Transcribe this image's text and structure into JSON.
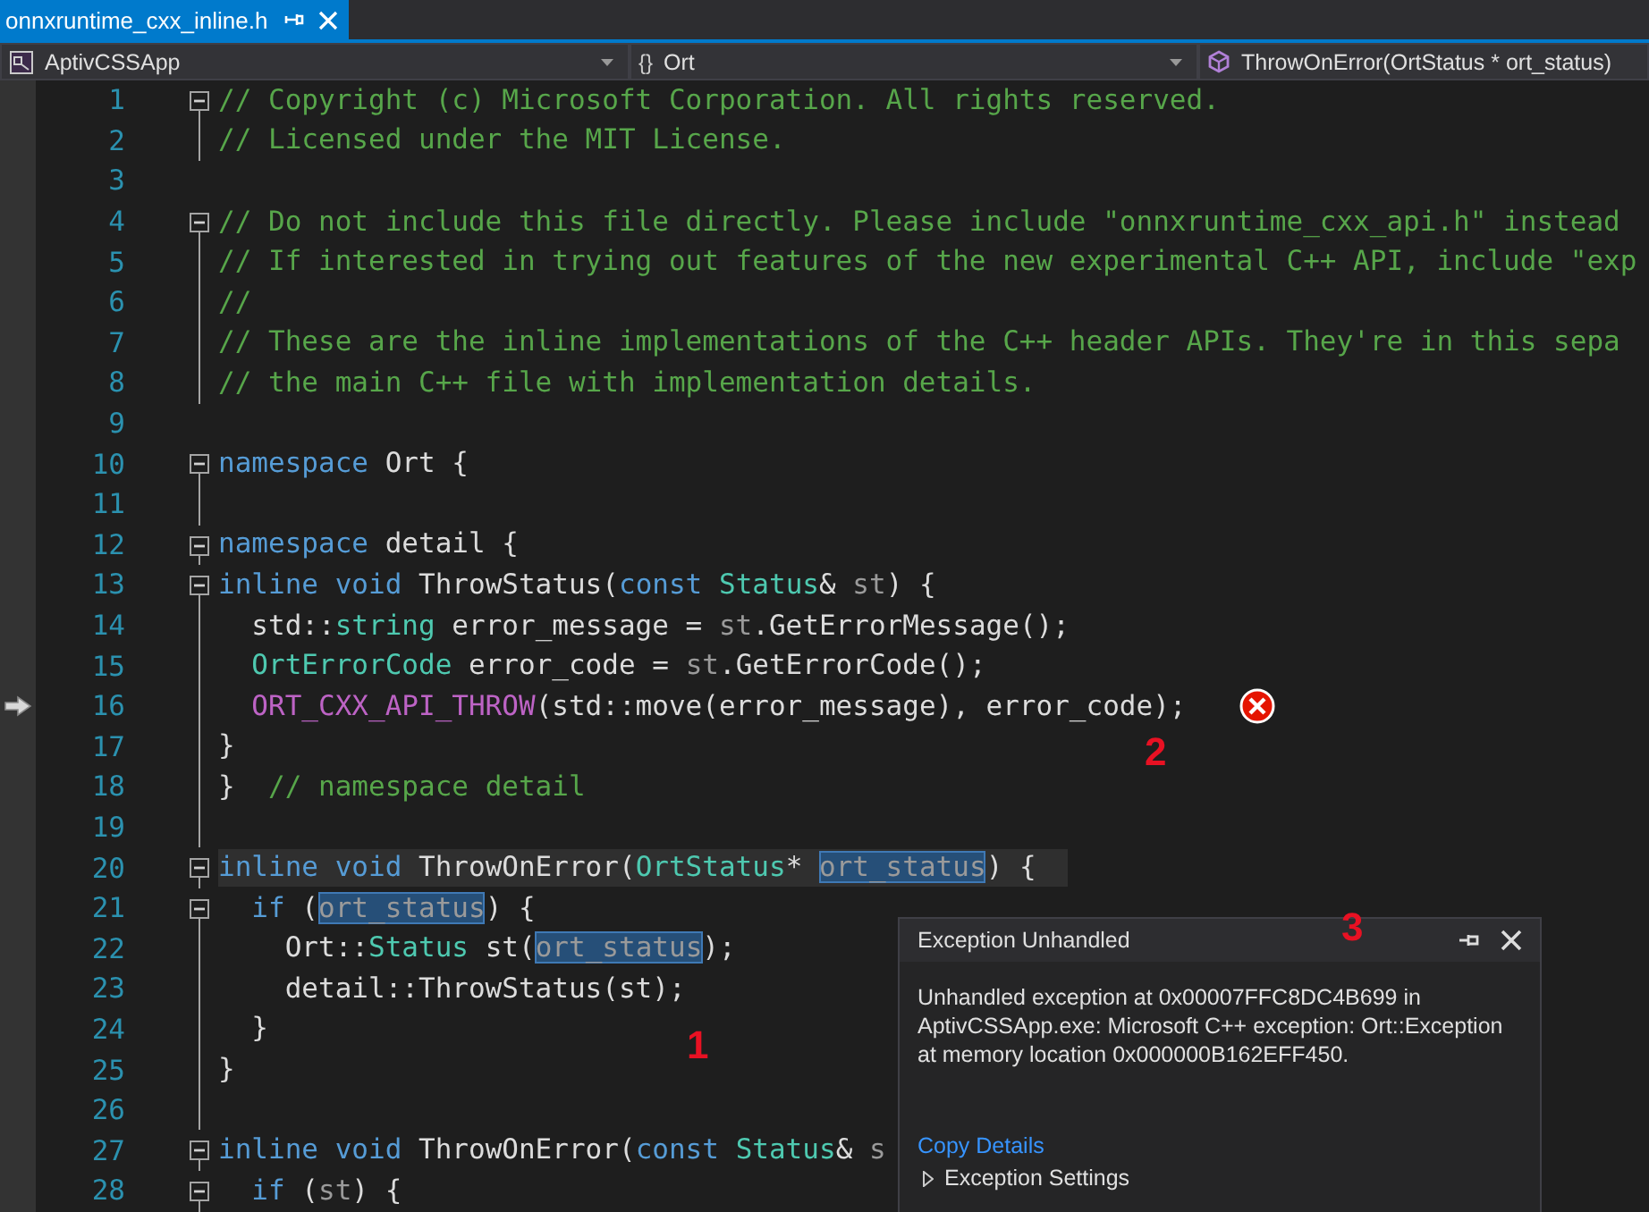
{
  "tabs": [
    {
      "label": "onnxruntime_cxx_inline.h",
      "selected": true
    }
  ],
  "navigation": {
    "project": "AptivCSSApp",
    "scope_glyph": "{}",
    "scope": "Ort",
    "member": "ThrowOnError(OrtStatus * ort_status)"
  },
  "lines": [
    {
      "number": "1",
      "foldable": true,
      "in_block": true,
      "tokens": [
        {
          "kind": "comment",
          "text": "// Copyright (c) Microsoft Corporation. All rights reserved."
        }
      ]
    },
    {
      "number": "2",
      "foldable": false,
      "in_block": true,
      "tokens": [
        {
          "kind": "comment",
          "text": "// Licensed under the MIT License."
        }
      ]
    },
    {
      "number": "3",
      "foldable": false,
      "in_block": false
    },
    {
      "number": "4",
      "foldable": true,
      "in_block": true,
      "tokens": [
        {
          "kind": "comment",
          "text": "// Do not include this file directly. Please include \"onnxruntime_cxx_api.h\" instead"
        }
      ]
    },
    {
      "number": "5",
      "foldable": false,
      "in_block": true,
      "tokens": [
        {
          "kind": "comment",
          "text": "// If interested in trying out features of the new experimental C++ API, include \"exp"
        }
      ]
    },
    {
      "number": "6",
      "foldable": false,
      "in_block": true,
      "tokens": [
        {
          "kind": "comment",
          "text": "//"
        }
      ]
    },
    {
      "number": "7",
      "foldable": false,
      "in_block": true,
      "tokens": [
        {
          "kind": "comment",
          "text": "// These are the inline implementations of the C++ header APIs. They're in this sepa"
        }
      ]
    },
    {
      "number": "8",
      "foldable": false,
      "in_block": true,
      "tokens": [
        {
          "kind": "comment",
          "text": "// the main C++ file with implementation details."
        }
      ]
    },
    {
      "number": "9",
      "foldable": false,
      "in_block": false
    },
    {
      "number": "10",
      "foldable": true,
      "in_block": true,
      "tokens": [
        {
          "kind": "keyword",
          "text": "namespace"
        },
        {
          "kind": "plain",
          "text": " Ort {"
        }
      ]
    },
    {
      "number": "11",
      "foldable": false,
      "in_block": true
    },
    {
      "number": "12",
      "foldable": true,
      "in_block": true,
      "tokens": [
        {
          "kind": "keyword",
          "text": "namespace"
        },
        {
          "kind": "plain",
          "text": " detail {"
        }
      ]
    },
    {
      "number": "13",
      "foldable": true,
      "in_block": true,
      "tokens": [
        {
          "kind": "keyword",
          "text": "inline void"
        },
        {
          "kind": "plain",
          "text": " ThrowStatus("
        },
        {
          "kind": "keyword",
          "text": "const"
        },
        {
          "kind": "type",
          "text": " Status"
        },
        {
          "kind": "plain",
          "text": "& "
        },
        {
          "kind": "param",
          "text": "st"
        },
        {
          "kind": "plain",
          "text": ") {"
        }
      ]
    },
    {
      "number": "14",
      "foldable": false,
      "in_block": true,
      "tokens": [
        {
          "kind": "plain",
          "text": "  std::"
        },
        {
          "kind": "type",
          "text": "string"
        },
        {
          "kind": "plain",
          "text": " error_message = "
        },
        {
          "kind": "param",
          "text": "st"
        },
        {
          "kind": "plain",
          "text": ".GetErrorMessage();"
        }
      ]
    },
    {
      "number": "15",
      "foldable": false,
      "in_block": true,
      "tokens": [
        {
          "kind": "type",
          "text": "  OrtErrorCode"
        },
        {
          "kind": "plain",
          "text": " error_code = "
        },
        {
          "kind": "param",
          "text": "st"
        },
        {
          "kind": "plain",
          "text": ".GetErrorCode();"
        }
      ]
    },
    {
      "number": "16",
      "foldable": false,
      "in_block": true,
      "current": true,
      "error": true,
      "tokens": [
        {
          "kind": "macro",
          "text": "  ORT_CXX_API_THROW"
        },
        {
          "kind": "plain",
          "text": "(std::move(error_message), error_code);"
        }
      ]
    },
    {
      "number": "17",
      "foldable": false,
      "in_block": true,
      "tokens": [
        {
          "kind": "plain",
          "text": "}"
        }
      ]
    },
    {
      "number": "18",
      "foldable": false,
      "in_block": true,
      "tokens": [
        {
          "kind": "plain",
          "text": "}  "
        },
        {
          "kind": "comment",
          "text": "// namespace detail"
        }
      ]
    },
    {
      "number": "19",
      "foldable": false,
      "in_block": true
    },
    {
      "number": "20",
      "foldable": true,
      "in_block": true,
      "highlight": true,
      "tokens": [
        {
          "kind": "keyword",
          "text": "inline void"
        },
        {
          "kind": "plain",
          "text": " ThrowOnError("
        },
        {
          "kind": "type",
          "text": "OrtStatus"
        },
        {
          "kind": "plain",
          "text": "* "
        },
        {
          "kind": "reference",
          "text": "ort_status"
        },
        {
          "kind": "plain",
          "text": ") {"
        }
      ]
    },
    {
      "number": "21",
      "foldable": true,
      "in_block": true,
      "tokens": [
        {
          "kind": "keyword",
          "text": "  if"
        },
        {
          "kind": "plain",
          "text": " ("
        },
        {
          "kind": "reference",
          "text": "ort_status"
        },
        {
          "kind": "plain",
          "text": ") {"
        }
      ]
    },
    {
      "number": "22",
      "foldable": false,
      "in_block": true,
      "tokens": [
        {
          "kind": "plain",
          "text": "    Ort::"
        },
        {
          "kind": "type",
          "text": "Status"
        },
        {
          "kind": "plain",
          "text": " st("
        },
        {
          "kind": "reference",
          "text": "ort_status"
        },
        {
          "kind": "plain",
          "text": ");"
        }
      ]
    },
    {
      "number": "23",
      "foldable": false,
      "in_block": true,
      "tokens": [
        {
          "kind": "plain",
          "text": "    detail::ThrowStatus(st);"
        }
      ]
    },
    {
      "number": "24",
      "foldable": false,
      "in_block": true,
      "tokens": [
        {
          "kind": "plain",
          "text": "  }"
        }
      ]
    },
    {
      "number": "25",
      "foldable": false,
      "in_block": true,
      "tokens": [
        {
          "kind": "plain",
          "text": "}"
        }
      ]
    },
    {
      "number": "26",
      "foldable": false,
      "in_block": true
    },
    {
      "number": "27",
      "foldable": true,
      "in_block": true,
      "tokens": [
        {
          "kind": "keyword",
          "text": "inline void"
        },
        {
          "kind": "plain",
          "text": " ThrowOnError("
        },
        {
          "kind": "keyword",
          "text": "const"
        },
        {
          "kind": "type",
          "text": " Status"
        },
        {
          "kind": "plain",
          "text": "& "
        },
        {
          "kind": "param",
          "text": "s"
        }
      ]
    },
    {
      "number": "28",
      "foldable": true,
      "in_block": true,
      "tokens": [
        {
          "kind": "keyword",
          "text": "  if"
        },
        {
          "kind": "plain",
          "text": " ("
        },
        {
          "kind": "param",
          "text": "st"
        },
        {
          "kind": "plain",
          "text": ") {"
        }
      ]
    }
  ],
  "annotations": [
    {
      "text": "2"
    },
    {
      "text": "1"
    },
    {
      "text": "3"
    }
  ],
  "exception_popup": {
    "title": "Exception Unhandled",
    "message": "Unhandled exception at 0x00007FFC8DC4B699 in AptivCSSApp.exe: Microsoft C++ exception: Ort::Exception at memory location 0x000000B162EFF450.",
    "link": "Copy Details",
    "settings": {
      "label": "Exception Settings",
      "expanded": false
    }
  }
}
